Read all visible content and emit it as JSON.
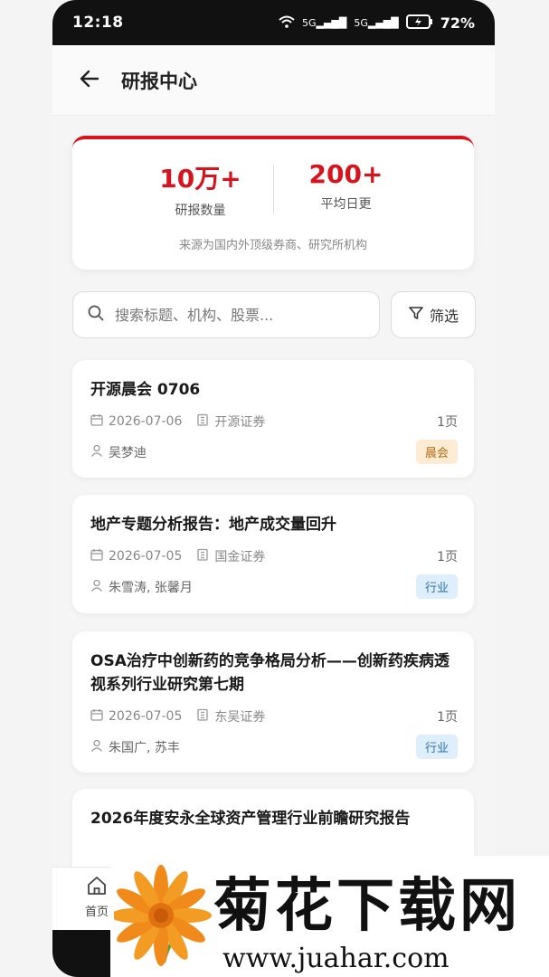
{
  "status": {
    "time": "12:18",
    "network1": "5G",
    "network2": "5G",
    "battery": "72%"
  },
  "header": {
    "back_icon": "arrow-left-icon",
    "title": "研报中心"
  },
  "stats": {
    "count_value": "10万+",
    "count_label": "研报数量",
    "daily_value": "200+",
    "daily_label": "平均日更",
    "source": "来源为国内外顶级券商、研究所机构"
  },
  "search": {
    "placeholder": "搜索标题、机构、股票..."
  },
  "filter": {
    "label": "筛选"
  },
  "reports": [
    {
      "title": "开源晨会 0706",
      "date": "2026-07-06",
      "institution": "开源证券",
      "pages": "1页",
      "authors": "吴梦迪",
      "tag": "晨会"
    },
    {
      "title": "地产专题分析报告：地产成交量回升",
      "date": "2026-07-05",
      "institution": "国金证券",
      "pages": "1页",
      "authors": "朱雪涛, 张馨月",
      "tag": "行业"
    },
    {
      "title": "OSA治疗中创新药的竞争格局分析——创新药疾病透视系列行业研究第七期",
      "date": "2026-07-05",
      "institution": "东吴证券",
      "pages": "1页",
      "authors": "朱国广, 苏丰",
      "tag": "行业"
    },
    {
      "title": "2026年度安永全球资产管理行业前瞻研究报告"
    }
  ],
  "tabbar": {
    "home_label": "首页"
  },
  "watermark": {
    "title": "菊花下载网",
    "url": "www.juahar.com"
  },
  "colors": {
    "accent": "#d7141e",
    "tag_orange_bg": "#fdecd3",
    "tag_blue_bg": "#deeefb"
  }
}
